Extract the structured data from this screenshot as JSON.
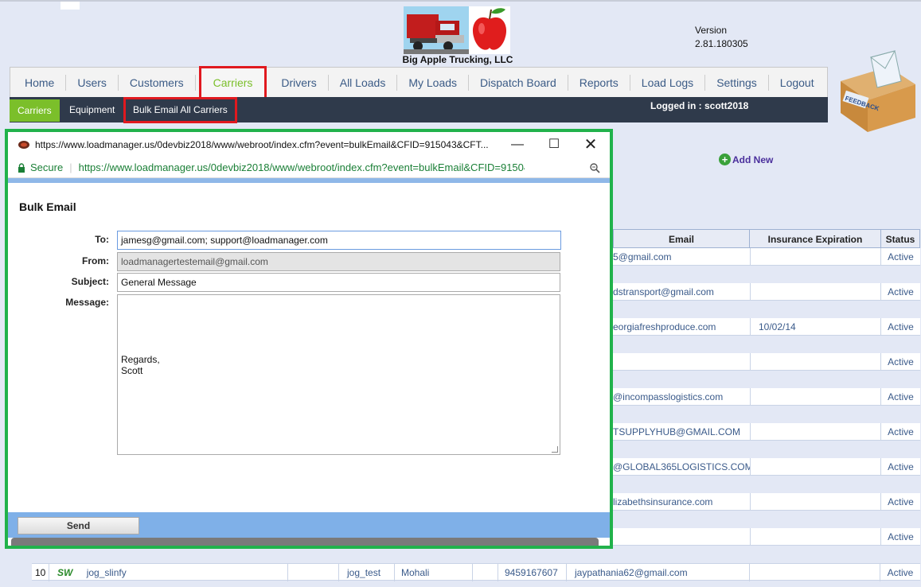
{
  "app": {
    "company": "Big Apple Trucking, LLC",
    "version_label": "Version",
    "version": "2.81.180305",
    "logged_in": "Logged in : scott2018"
  },
  "nav": {
    "items": [
      "Home",
      "Users",
      "Customers",
      "Carriers",
      "Drivers",
      "All Loads",
      "My Loads",
      "Dispatch Board",
      "Reports",
      "Load Logs",
      "Settings",
      "Logout"
    ],
    "active": "Carriers"
  },
  "subnav": {
    "carriers": "Carriers",
    "equipment": "Equipment",
    "bulk_email": "Bulk Email All Carriers"
  },
  "add_new": "Add New",
  "table": {
    "headers": {
      "email": "Email",
      "insurance": "Insurance Expiration",
      "status": "Status"
    },
    "rows": [
      {
        "email": "5@gmail.com",
        "insurance": "",
        "status": "Active"
      },
      {
        "email": "dstransport@gmail.com",
        "insurance": "",
        "status": "Active"
      },
      {
        "email": "eorgiafreshproduce.com",
        "insurance": "10/02/14",
        "status": "Active"
      },
      {
        "email": "",
        "insurance": "",
        "status": "Active"
      },
      {
        "email": "@incompasslogistics.com",
        "insurance": "",
        "status": "Active"
      },
      {
        "email": "TSUPPLYHUB@GMAIL.COM",
        "insurance": "",
        "status": "Active"
      },
      {
        "email": "@GLOBAL365LOGISTICS.COM",
        "insurance": "",
        "status": "Active"
      },
      {
        "email": "lizabethsinsurance.com",
        "insurance": "",
        "status": "Active"
      },
      {
        "email": "",
        "insurance": "",
        "status": "Active"
      }
    ],
    "last_row": {
      "num": "10",
      "logo": "SW",
      "name": "jog_slinfy",
      "col3": "",
      "contact": "jog_test",
      "city": "Mohali",
      "col6": "",
      "phone": "9459167607",
      "email": "jaypathania62@gmail.com",
      "insurance": "",
      "status": "Active"
    }
  },
  "popup": {
    "title": "https://www.loadmanager.us/0devbiz2018/www/webroot/index.cfm?event=bulkEmail&CFID=915043&CFT...",
    "secure": "Secure",
    "url": "https://www.loadmanager.us/0devbiz2018/www/webroot/index.cfm?event=bulkEmail&CFID=915043...",
    "form_title": "Bulk Email",
    "to_label": "To:",
    "to_value": "jamesg@gmail.com; support@loadmanager.com",
    "from_label": "From:",
    "from_value": "loadmanagertestemail@gmail.com",
    "subject_label": "Subject:",
    "subject_value": "General Message",
    "message_label": "Message:",
    "message_value": "Regards,\nScott",
    "send": "Send"
  },
  "colors": {
    "highlight_red": "#e0191f",
    "popup_border": "#21b24b",
    "nav_active": "#7bbf2a",
    "subnav_bg": "#2f3a4b"
  }
}
